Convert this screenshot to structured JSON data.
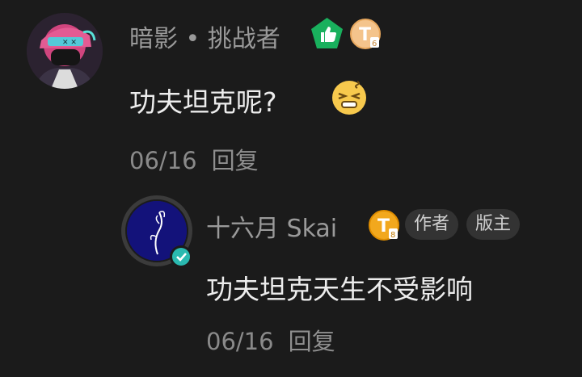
{
  "comment": {
    "username": "暗影 • 挑战者",
    "text": "功夫坦克呢?",
    "date": "06/16",
    "reply_label": "回复",
    "emoji": "squinting-face-emoji",
    "badges": {
      "level_icon": "thumbs-up-pentagon-icon",
      "level_color": "#19b05d",
      "title_badge": "T",
      "title_badge_color": "#f4b86a"
    }
  },
  "reply": {
    "username": "十六月 Skai",
    "text": "功夫坦克天生不受影响",
    "date": "06/16",
    "reply_label": "回复",
    "tags": [
      "作者",
      "版主"
    ],
    "verified_icon": "verified-check-icon",
    "verified_color": "#2ab9b0",
    "title_badge": "T",
    "title_badge_color": "#f2a81d"
  }
}
